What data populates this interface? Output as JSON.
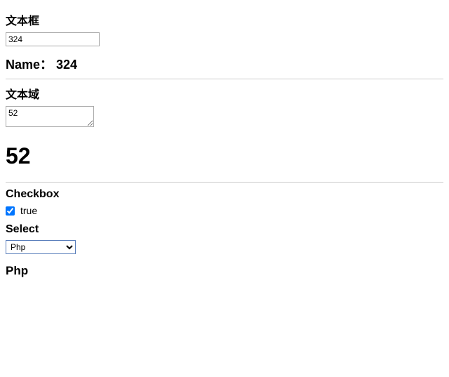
{
  "section1": {
    "heading": "文本框",
    "input_value": "324",
    "output_prefix": "Name： ",
    "output_value": "324"
  },
  "section2": {
    "heading": "文本域",
    "textarea_value": "52",
    "output_value": "52"
  },
  "section3": {
    "heading": "Checkbox",
    "checked": true,
    "checkbox_label": "true"
  },
  "section4": {
    "heading": "Select",
    "selected": "Php",
    "output_value": "Php"
  }
}
